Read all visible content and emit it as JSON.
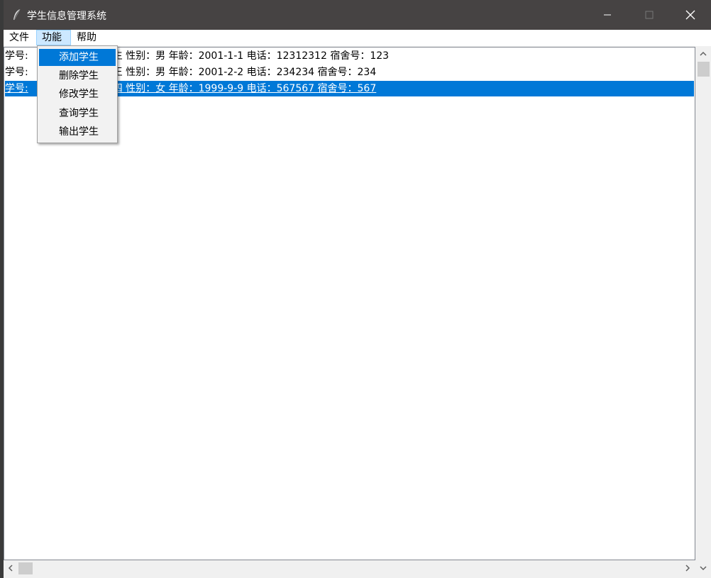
{
  "window": {
    "title": "学生信息管理系统"
  },
  "titlebar": {
    "minimize_icon": "minimize-icon",
    "maximize_icon": "maximize-icon",
    "close_icon": "close-icon",
    "app_icon": "feather-icon"
  },
  "menubar": {
    "file": "文件",
    "function": "功能",
    "help": "帮助"
  },
  "function_menu": {
    "items": [
      {
        "label": "添加学生",
        "active": true
      },
      {
        "label": "删除学生",
        "active": false
      },
      {
        "label": "修改学生",
        "active": false
      },
      {
        "label": "查询学生",
        "active": false
      },
      {
        "label": "输出学生",
        "active": false
      }
    ]
  },
  "student_list": {
    "rows": [
      {
        "prefix": "学号:",
        "rest": "生  性别：男  年龄：2001-1-1  电话：12312312  宿舍号：123",
        "selected": false
      },
      {
        "prefix": "学号:",
        "rest": "王  性别：男  年龄：2001-2-2  电话：234234  宿舍号：234",
        "selected": false
      },
      {
        "prefix": "学号:",
        "rest": "四  性别：女  年龄：1999-9-9  电话：567567  宿舍号：567",
        "selected": true
      }
    ]
  },
  "colors": {
    "titlebar": "#464343",
    "selection": "#0078d7",
    "menu_highlight": "#cce8ff"
  }
}
